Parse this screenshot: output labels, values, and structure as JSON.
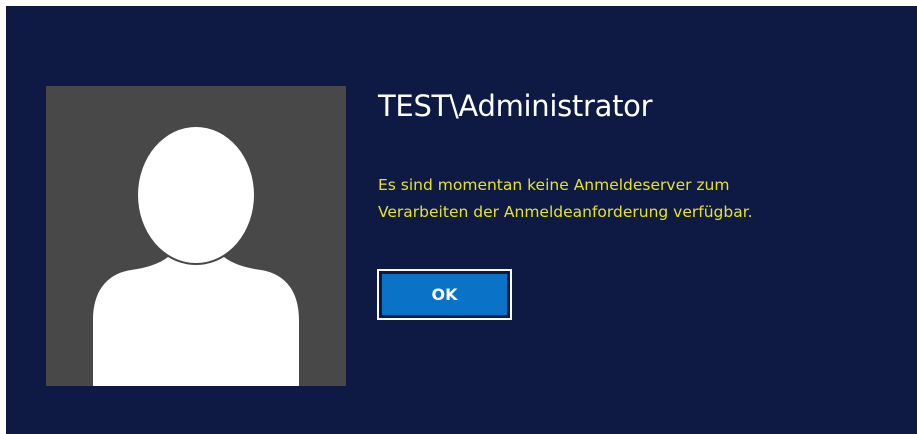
{
  "user": {
    "account_name": "TEST\\Administrator",
    "avatar_icon": "default-user-silhouette-icon"
  },
  "message": {
    "line1": "Es sind momentan keine Anmeldeserver zum",
    "line2": "Verarbeiten der Anmeldeanforderung verfügbar."
  },
  "ok_button": {
    "label": "OK"
  },
  "colors": {
    "background": "#0e1a44",
    "avatar_tile": "#484848",
    "message_text": "#e6e22c",
    "button_fill": "#0a72c7",
    "button_border": "#ffffff"
  }
}
